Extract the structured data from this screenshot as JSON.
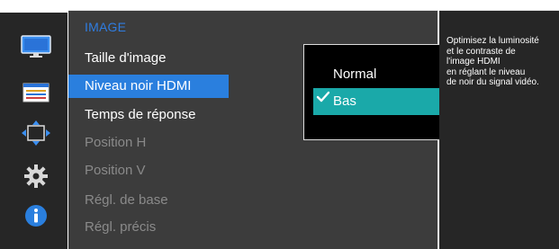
{
  "menu": {
    "title": "IMAGE",
    "items": [
      {
        "label": "Taille d'image",
        "state": "enabled"
      },
      {
        "label": "Niveau noir HDMI",
        "state": "selected"
      },
      {
        "label": "Temps de réponse",
        "state": "enabled"
      },
      {
        "label": "Position H",
        "state": "disabled"
      },
      {
        "label": "Position V",
        "state": "disabled"
      },
      {
        "label": "Régl. de base",
        "state": "disabled"
      },
      {
        "label": "Régl. précis",
        "state": "disabled"
      }
    ]
  },
  "submenu": {
    "options": [
      {
        "label": "Normal",
        "selected": false
      },
      {
        "label": "Bas",
        "selected": true
      }
    ]
  },
  "help": {
    "text": "Optimisez la luminosité\net le contraste de\nl'image HDMI\nen réglant le niveau\nde noir du signal vidéo."
  },
  "sidebar_icons": [
    "monitor-icon",
    "settings-list-icon",
    "resize-arrows-icon",
    "gear-icon",
    "info-icon"
  ],
  "colors": {
    "accent": "#2a7fde",
    "highlight": "#1aa9a9",
    "title": "#2f7de1"
  }
}
